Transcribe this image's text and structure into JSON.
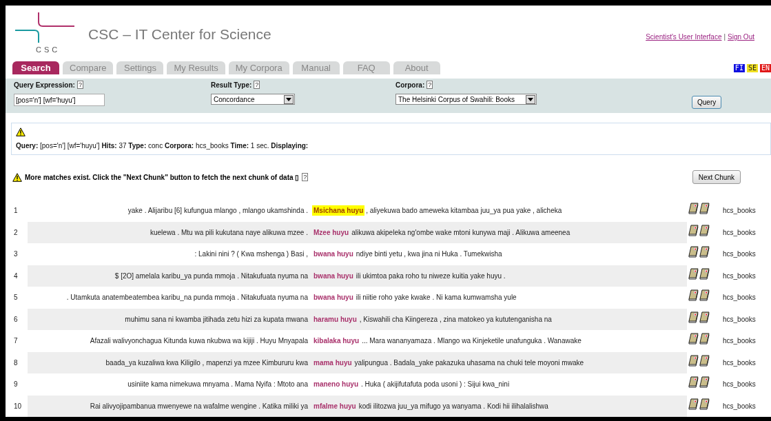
{
  "header": {
    "title": "CSC – IT Center for Science",
    "logo_text": "CSC",
    "links": [
      "Scientist's User Interface",
      "Sign Out"
    ],
    "separator": "|"
  },
  "tabs": [
    {
      "label": "Search",
      "selected": true
    },
    {
      "label": "Compare",
      "selected": false
    },
    {
      "label": "Settings",
      "selected": false
    },
    {
      "label": "My Results",
      "selected": false
    },
    {
      "label": "My  Corpora",
      "selected": false
    },
    {
      "label": "Manual",
      "selected": false
    },
    {
      "label": "FAQ",
      "selected": false
    },
    {
      "label": "About",
      "selected": false
    }
  ],
  "languages": [
    {
      "label": "FI",
      "color": "#1010e0"
    },
    {
      "label": "SE",
      "color": "#f0e020"
    },
    {
      "label": "EN",
      "color": "#e01818"
    }
  ],
  "form": {
    "fields": [
      {
        "label": "Query Expression:",
        "help": "?",
        "kind": "input",
        "value": "[pos='n'] [wf='huyu']"
      },
      {
        "label": "Result Type:",
        "help": "?",
        "kind": "select",
        "value": "Concordance"
      },
      {
        "label": "Corpora:",
        "help": "?",
        "kind": "select",
        "value": "The Helsinki Corpus of Swahili: Books"
      }
    ],
    "button": "Query"
  },
  "summary": "**Query:** [pos='n'] [wf='huyu'] **Hits:** 37 **Type:** conc **Corpora:** hcs_books **Time:** 1 sec. **Displaying:**",
  "notice": {
    "text": "More matches exist. Click the \"Next Chunk\" button to fetch the next chunk of data ▯",
    "help": "?",
    "button": "Next Chunk"
  },
  "rows": [
    {
      "num": "1",
      "left": "yake . Alijaribu [6] kufungua mlango , mlango ukamshinda .",
      "match": "Msichana huyu",
      "right": ", aliyekuwa bado ameweka kitambaa juu_ya pua yake , alicheka",
      "corpus": "hcs_books",
      "highlighted": true
    },
    {
      "num": "2",
      "left": "kuelewa . Mtu wa pili kukutana naye alikuwa mzee .",
      "match": "Mzee huyu",
      "right": "alikuwa akipeleka ng'ombe wake mtoni kunywa maji . Alikuwa ameenea",
      "corpus": "hcs_books",
      "highlighted": false
    },
    {
      "num": "3",
      "left": ": Lakini nini ? ( Kwa mshenga ) Basi ,",
      "match": "bwana huyu",
      "right": "ndiye binti yetu , kwa jina ni Huka . Tumekwisha",
      "corpus": "hcs_books",
      "highlighted": false
    },
    {
      "num": "4",
      "left": "$ [2O] amelala karibu_ya punda mmoja . Nitakufuata nyuma na",
      "match": "bwana huyu",
      "right": "ili ukimtoa paka roho tu niweze kuitia yake huyu .",
      "corpus": "hcs_books",
      "highlighted": false
    },
    {
      "num": "5",
      "left": ". Utamkuta anatembeatembea karibu_na punda mmoja . Nitakufuata nyuma na",
      "match": "bwana huyu",
      "right": "ili niitie roho yake kwake . Ni kama kumwamsha yule",
      "corpus": "hcs_books",
      "highlighted": false
    },
    {
      "num": "6",
      "left": "muhimu sana ni kwamba jitihada zetu hizi za kupata mwana",
      "match": "haramu huyu",
      "right": ", Kiswahili cha Kiingereza , zina matokeo ya kututenganisha na",
      "corpus": "hcs_books",
      "highlighted": false
    },
    {
      "num": "7",
      "left": "Afazali walivyonchagua Kitunda kuwa nkubwa wa kijiji . Huyu Mnyapala",
      "match": "kibalaka huyu",
      "right": "... Mara wananyamaza . Mlango wa Kinjeketile unafunguka . Wanawake",
      "corpus": "hcs_books",
      "highlighted": false
    },
    {
      "num": "8",
      "left": "baada_ya kuzaliwa kwa Kiligilo , mapenzi ya mzee Kimbururu kwa",
      "match": "mama huyu",
      "right": "yalipungua . Badala_yake pakazuka uhasama na chuki tele moyoni mwake",
      "corpus": "hcs_books",
      "highlighted": false
    },
    {
      "num": "9",
      "left": "usiniite kama nimekuwa mnyama . Mama Nyifa : Mtoto ana",
      "match": "maneno huyu",
      "right": ". Huka ( akijifutafuta poda usoni ) : Sijui kwa_nini",
      "corpus": "hcs_books",
      "highlighted": false
    },
    {
      "num": "10",
      "left": "Rai alivyojipambanua mwenyewe na wafalme wengine . Katika miliki ya",
      "match": "mfalme huyu",
      "right": "kodi ilitozwa juu_ya mifugo ya wanyama . Kodi hii ilihalalishwa",
      "corpus": "hcs_books",
      "highlighted": false
    }
  ]
}
